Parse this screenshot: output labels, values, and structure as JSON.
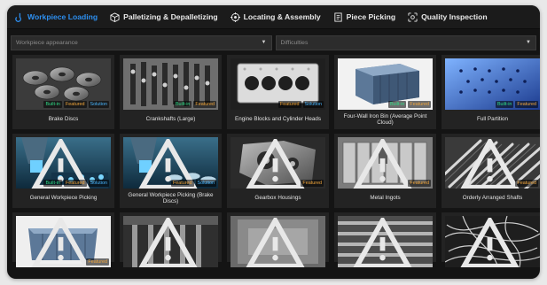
{
  "tabs": [
    {
      "label": "Workpiece Loading",
      "icon": "hook-icon",
      "active": true
    },
    {
      "label": "Palletizing & Depalletizing",
      "icon": "box-icon",
      "active": false
    },
    {
      "label": "Locating & Assembly",
      "icon": "target-icon",
      "active": false
    },
    {
      "label": "Piece Picking",
      "icon": "document-icon",
      "active": false
    },
    {
      "label": "Quality Inspection",
      "icon": "inspect-icon",
      "active": false
    }
  ],
  "filters": {
    "workpiece_appearance": "Workpiece appearance",
    "difficulties": "Difficulties"
  },
  "badge_labels": {
    "built_in": "Built-in",
    "featured": "Featured",
    "solution": "Solution"
  },
  "cards": [
    {
      "title": "Brake Discs",
      "badges": [
        "built_in",
        "featured",
        "solution"
      ],
      "warning": false
    },
    {
      "title": "Crankshafts (Large)",
      "badges": [
        "built_in",
        "featured"
      ],
      "warning": false
    },
    {
      "title": "Engine Blocks and Cylinder Heads",
      "badges": [
        "featured",
        "solution"
      ],
      "warning": false
    },
    {
      "title": "Four-Wall Iron Bin (Average Point Cloud)",
      "badges": [
        "built_in",
        "featured"
      ],
      "warning": false
    },
    {
      "title": "Full Partition",
      "badges": [
        "built_in",
        "featured"
      ],
      "warning": false
    },
    {
      "title": "General Workpiece Picking",
      "badges": [
        "built_in",
        "featured",
        "solution"
      ],
      "warning": true
    },
    {
      "title": "General Workpiece Picking (Brake Discs)",
      "badges": [
        "featured",
        "solution"
      ],
      "warning": true
    },
    {
      "title": "Gearbox Housings",
      "badges": [
        "featured"
      ],
      "warning": true
    },
    {
      "title": "Metal Ingots",
      "badges": [
        "featured"
      ],
      "warning": true
    },
    {
      "title": "Orderly Arranged Shafts",
      "badges": [
        "featured"
      ],
      "warning": true
    },
    {
      "title": "",
      "badges": [
        "featured"
      ],
      "warning": true
    },
    {
      "title": "",
      "badges": [],
      "warning": true
    },
    {
      "title": "",
      "badges": [],
      "warning": true
    },
    {
      "title": "",
      "badges": [],
      "warning": true
    },
    {
      "title": "",
      "badges": [],
      "warning": true
    }
  ]
}
